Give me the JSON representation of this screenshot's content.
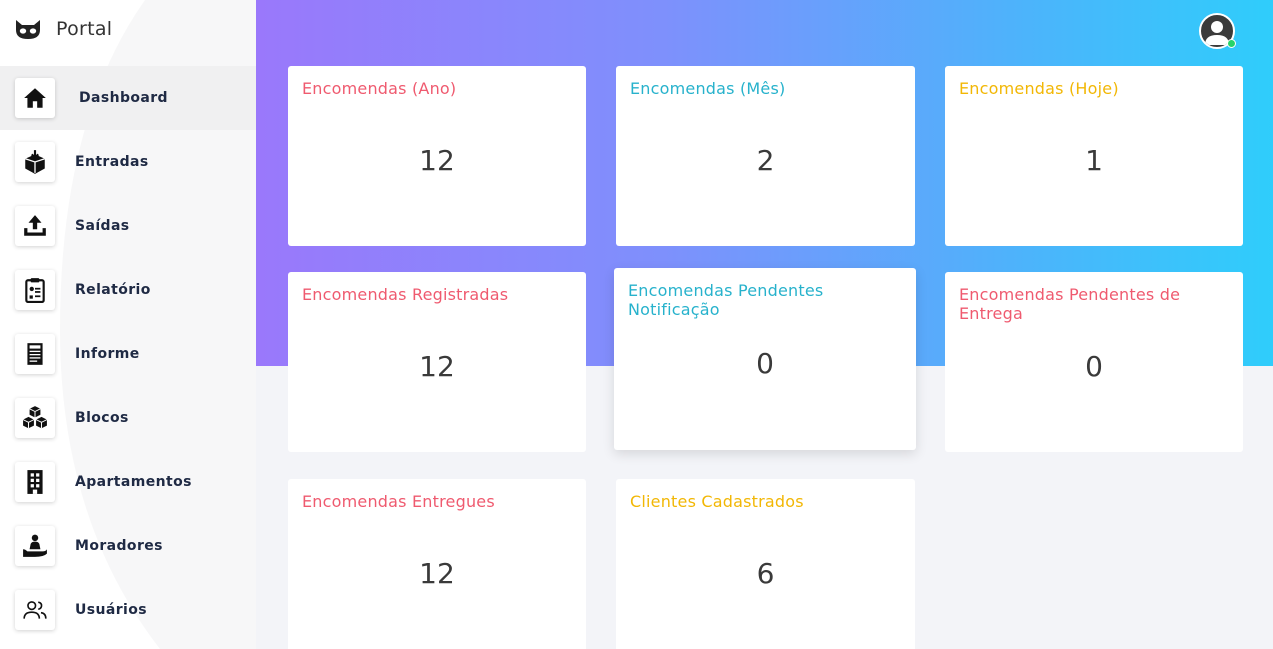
{
  "brand": {
    "name": "Portal",
    "logo_icon": "mask-logo-icon"
  },
  "sidebar": {
    "items": [
      {
        "label": "Dashboard",
        "icon": "home-icon",
        "active": true
      },
      {
        "label": "Entradas",
        "icon": "box-in-icon"
      },
      {
        "label": "Saídas",
        "icon": "upload-icon"
      },
      {
        "label": "Relatório",
        "icon": "clipboard-icon"
      },
      {
        "label": "Informe",
        "icon": "newspaper-icon"
      },
      {
        "label": "Blocos",
        "icon": "cubes-icon"
      },
      {
        "label": "Apartamentos",
        "icon": "building-icon"
      },
      {
        "label": "Moradores",
        "icon": "person-hand-icon"
      },
      {
        "label": "Usuários",
        "icon": "users-icon"
      }
    ]
  },
  "header": {
    "avatar_icon": "user-avatar-icon",
    "status": "online"
  },
  "colors": {
    "red": "#ef5a6f",
    "cyan": "#27b2cc",
    "yellow": "#f2b705",
    "gradient_start": "#9a78fb",
    "gradient_end": "#2fcdfb"
  },
  "cards": [
    {
      "title": "Encomendas (Ano)",
      "value": "12",
      "color": "red"
    },
    {
      "title": "Encomendas (Mês)",
      "value": "2",
      "color": "cyan"
    },
    {
      "title": "Encomendas (Hoje)",
      "value": "1",
      "color": "yellow"
    },
    {
      "title": "Encomendas Registradas",
      "value": "12",
      "color": "red"
    },
    {
      "title": "Encomendas Pendentes Notificação",
      "value": "0",
      "color": "cyan"
    },
    {
      "title": "Encomendas Pendentes de Entrega",
      "value": "0",
      "color": "red"
    },
    {
      "title": "Encomendas Entregues",
      "value": "12",
      "color": "red"
    },
    {
      "title": "Clientes Cadastrados",
      "value": "6",
      "color": "yellow"
    }
  ]
}
